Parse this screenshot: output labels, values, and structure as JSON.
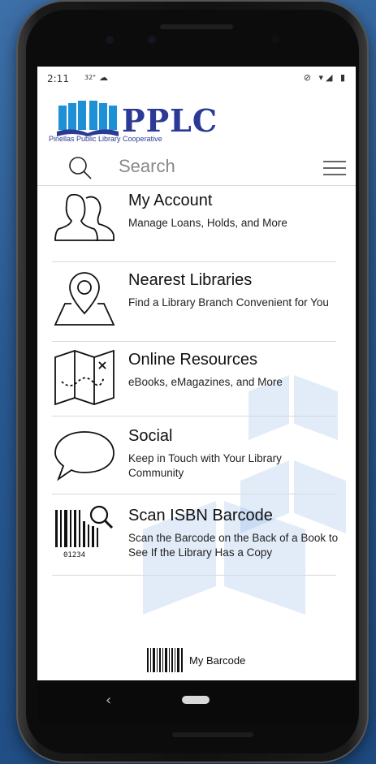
{
  "status": {
    "time": "2:11",
    "temp": "32°",
    "weather_icon": "cloud-icon",
    "right_icons": "⊘ ▾◢ ▮"
  },
  "logo": {
    "name": "PPLC",
    "tagline": "Pinellas Public Library Cooperative"
  },
  "search": {
    "placeholder": "Search"
  },
  "menu": [
    {
      "title": "My Account",
      "subtitle": "Manage Loans, Holds, and More",
      "icon": "users-icon"
    },
    {
      "title": "Nearest Libraries",
      "subtitle": "Find a Library Branch Convenient for You",
      "icon": "map-pin-icon"
    },
    {
      "title": "Online Resources",
      "subtitle": "eBooks, eMagazines, and More",
      "icon": "treasure-map-icon"
    },
    {
      "title": "Social",
      "subtitle": "Keep in Touch with Your Library Community",
      "icon": "speech-bubble-icon"
    },
    {
      "title": "Scan ISBN Barcode",
      "subtitle": "Scan the Barcode on the Back of a Book to See If the Library Has a Copy",
      "icon": "barcode-scan-icon",
      "barcode_digits": "01234"
    }
  ],
  "footer": {
    "barcode_label": "My Barcode"
  },
  "colors": {
    "brand": "#2b3a94",
    "brand_light": "#1e90d6"
  }
}
